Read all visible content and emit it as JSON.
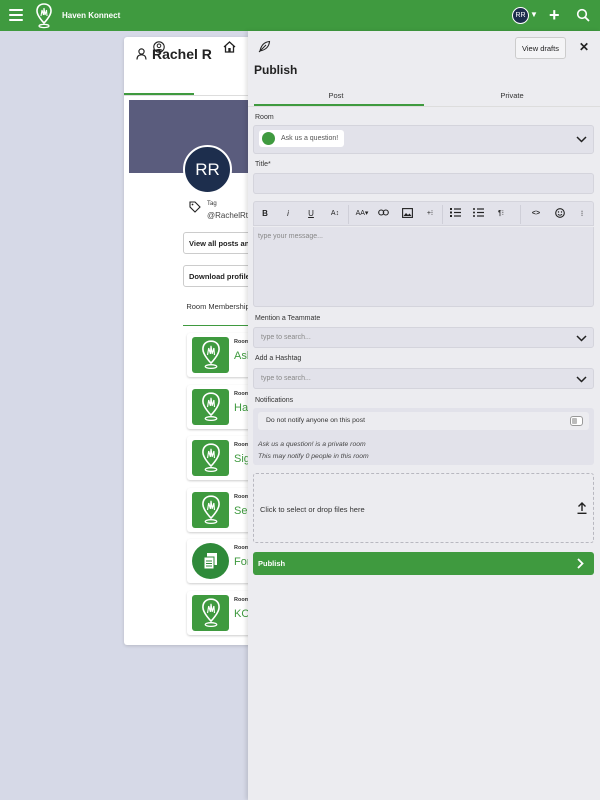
{
  "app": {
    "name": "Haven Konnect",
    "user_initials": "RR",
    "caret": "▼",
    "plus": "+"
  },
  "profile": {
    "name": "Rachel R",
    "initials": "RR",
    "tag_label": "Tag",
    "handle": "@RachelRt",
    "view_all_label": "View all posts an",
    "download_label": "Download profile",
    "room_membership_label": "Room Membership",
    "rooms": [
      {
        "label": "Room",
        "name": "Ask",
        "icon": "location-grass-icon"
      },
      {
        "label": "Room",
        "name": "Ha",
        "icon": "location-grass-icon"
      },
      {
        "label": "Room",
        "name": "Sig",
        "icon": "location-grass-icon"
      },
      {
        "label": "Room",
        "name": "Sel",
        "icon": "location-grass-icon"
      },
      {
        "label": "Room",
        "name": "For",
        "icon": "document-icon"
      },
      {
        "label": "Room",
        "name": "KO",
        "icon": "location-grass-icon"
      }
    ]
  },
  "panel": {
    "title": "Publish",
    "view_drafts": "View drafts",
    "close": "✕",
    "tabs": [
      "Post",
      "Private"
    ],
    "room_label": "Room",
    "room_value": "Ask us a question!",
    "title_label": "Title*",
    "title_value": "",
    "editor_placeholder": "type your message...",
    "mention_label": "Mention a Teammate",
    "mention_placeholder": "type to search...",
    "hashtag_label": "Add a Hashtag",
    "hashtag_placeholder": "type to search...",
    "notifications_label": "Notifications",
    "notify_toggle_label": "Do not notify anyone on this post",
    "notify_info_1": "Ask us a question! is a private room",
    "notify_info_2": "This may notify 0 people in this room",
    "drop_label": "Click to select or drop files here",
    "publish_button": "Publish",
    "toolbar": {
      "bold": "B",
      "italic": "i",
      "underline": "U",
      "text_size": "A↕",
      "font": "AA▾",
      "insert": "+⁝",
      "paragraph": "¶⁝",
      "code": "<>",
      "more": "⁝"
    }
  },
  "colors": {
    "brand_green": "#3f9a3f",
    "navy": "#1d2e4d",
    "banner": "#5a5c7d"
  }
}
